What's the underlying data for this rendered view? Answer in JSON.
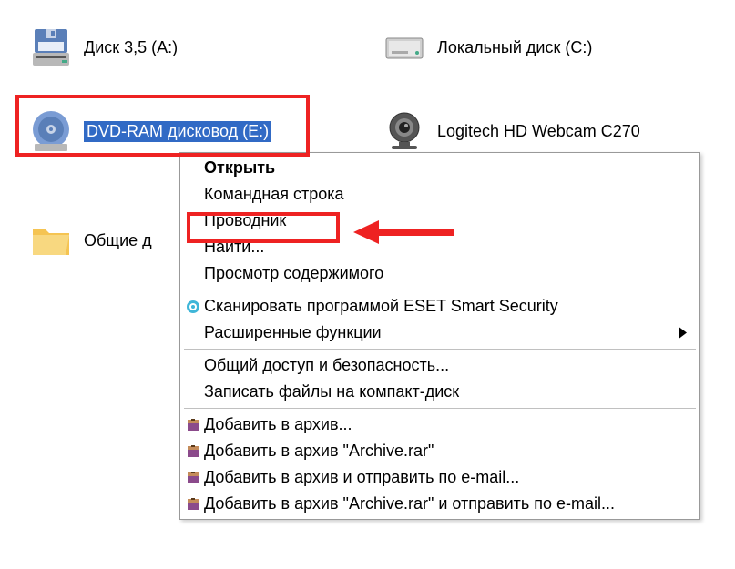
{
  "drives": {
    "floppy": {
      "label": "Диск 3,5 (A:)"
    },
    "local": {
      "label": "Локальный диск (C:)"
    },
    "dvd": {
      "label": "DVD-RAM дисковод (E:)"
    },
    "webcam": {
      "label": "Logitech HD Webcam C270"
    },
    "shared": {
      "label": "Общие д"
    }
  },
  "menu": {
    "open": "Открыть",
    "cmd": "Командная строка",
    "explorer": "Проводник",
    "find": "Найти...",
    "view_contents": "Просмотр содержимого",
    "eset_scan": "Сканировать программой ESET Smart Security",
    "advanced": "Расширенные функции",
    "sharing": "Общий доступ и безопасность...",
    "burn": "Записать файлы на компакт-диск",
    "archive_add": "Добавить в архив...",
    "archive_add_named": "Добавить в архив \"Archive.rar\"",
    "archive_email": "Добавить в архив и отправить по e-mail...",
    "archive_email_named": "Добавить в архив \"Archive.rar\" и отправить по e-mail..."
  }
}
